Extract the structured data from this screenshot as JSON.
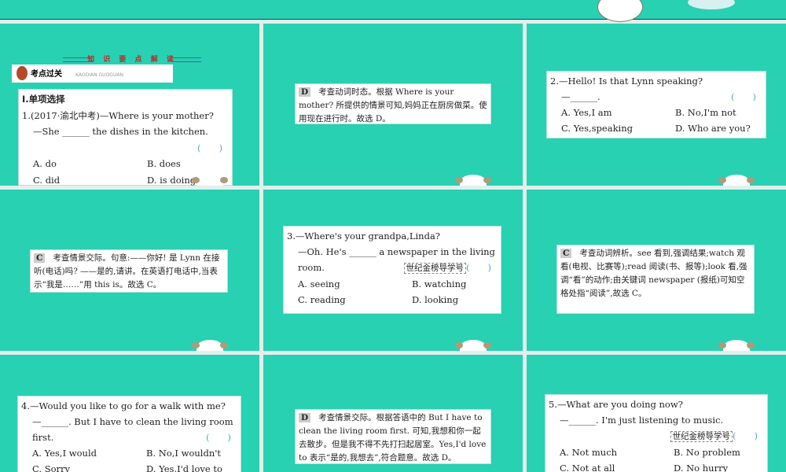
{
  "colors": {
    "bg": "#27d1b1",
    "answer_paren": "#4aa8d8"
  },
  "slide1": {
    "banner": "知 识 要 点 解 读",
    "section": "考点过关",
    "section_en": "KAODIAN GUOGUAN",
    "heading": "Ⅰ.单项选择",
    "q": "1.(2017·渝北中考)—Where is your mother?",
    "q2": "—She ______ the dishes in the kitchen.",
    "paren": "(　　)",
    "opts": [
      "A. do",
      "B. does",
      "C. did",
      "D. is doing"
    ]
  },
  "slide2": {
    "tag": "D",
    "text": "考查动词时态。根据 Where is your mother? 所提供的情景可知,妈妈正在厨房做菜。使用现在进行时。故选 D。"
  },
  "slide3": {
    "q": "2.—Hello! Is that Lynn speaking?",
    "q2": "—______.",
    "paren": "(　　)",
    "opts": [
      "A. Yes,I am",
      "B. No,I'm not",
      "C. Yes,speaking",
      "D. Who are you?"
    ]
  },
  "slide4": {
    "tag": "C",
    "text": "考查情景交际。句意:——你好! 是 Lynn 在接听(电话)吗? ——是的,请讲。在英语打电话中,当表示“我是……”用 this is。故选 C。"
  },
  "slide5": {
    "q": "3.—Where's your grandpa,Linda?",
    "q2": "—Oh. He's ______ a newspaper in the living",
    "q3": "room.",
    "stamp": "世纪金榜导学号",
    "paren": "(　　)",
    "opts": [
      "A. seeing",
      "B. watching",
      "C. reading",
      "D. looking"
    ]
  },
  "slide6": {
    "tag": "C",
    "text": "考查动词辨析。see 看到,强调结果;watch 观看(电视、比赛等);read 阅读(书、报等);look 看,强调“看”的动作;由关键词 newspaper (报纸)可知空格处指“阅读”,故选 C。"
  },
  "slide7": {
    "q": "4.—Would you like to go for a walk with me?",
    "q2": "—______. But I have to clean the living room",
    "q3": "first.",
    "paren": "(　　)",
    "opts": [
      "A. Yes,I would",
      "B. No,I wouldn't",
      "C. Sorry",
      "D. Yes,I'd love to"
    ]
  },
  "slide8": {
    "tag": "D",
    "text": "考查情景交际。根据答语中的 But I have to clean the living room first. 可知,我想和你一起去散步。但是我不得不先打扫起居室。Yes,I'd love to 表示“是的,我想去”,符合题意。故选 D。"
  },
  "slide9": {
    "q": "5.—What are you doing now?",
    "q2": "—______. I'm just listening to music.",
    "stamp": "世纪金榜导学号",
    "paren": "(　　)",
    "opts": [
      "A. Not much",
      "B. No problem",
      "C. Not at all",
      "D. No hurry"
    ]
  }
}
